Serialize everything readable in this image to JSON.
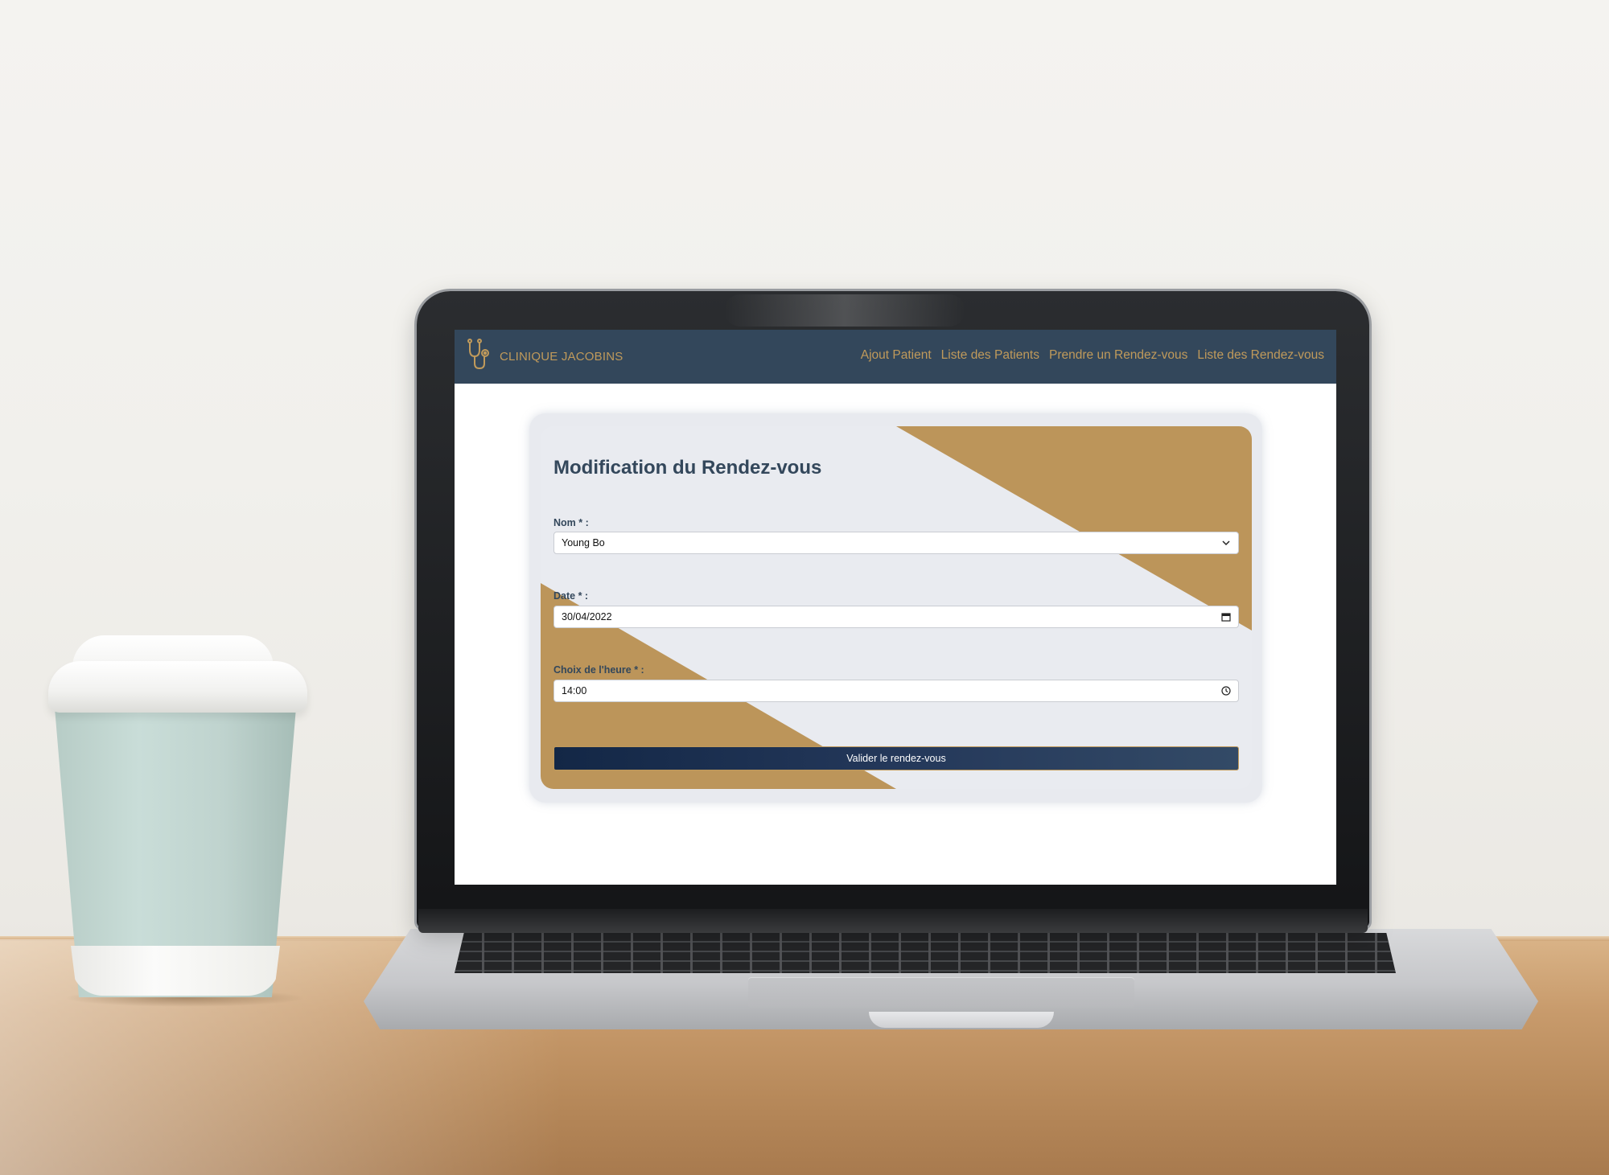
{
  "colors": {
    "navbar": "#33475b",
    "accent_gold": "#c09a5b",
    "card_background": "#e9ebf0",
    "button": "#1b2f4d"
  },
  "navbar": {
    "brand": {
      "icon": "stethoscope-icon",
      "name": "CLINIQUE JACOBINS"
    },
    "links": [
      "Ajout Patient",
      "Liste des Patients",
      "Prendre un Rendez-vous",
      "Liste des Rendez-vous"
    ]
  },
  "form": {
    "title": "Modification du Rendez-vous",
    "name_field": {
      "label": "Nom * :",
      "value": "Young Bo",
      "icon": "chevron-down-icon"
    },
    "date_field": {
      "label": "Date * :",
      "value": "30/04/2022",
      "icon": "calendar-icon"
    },
    "time_field": {
      "label": "Choix de l'heure * :",
      "value": "14:00",
      "icon": "clock-icon"
    },
    "submit_label": "Valider le rendez-vous"
  }
}
